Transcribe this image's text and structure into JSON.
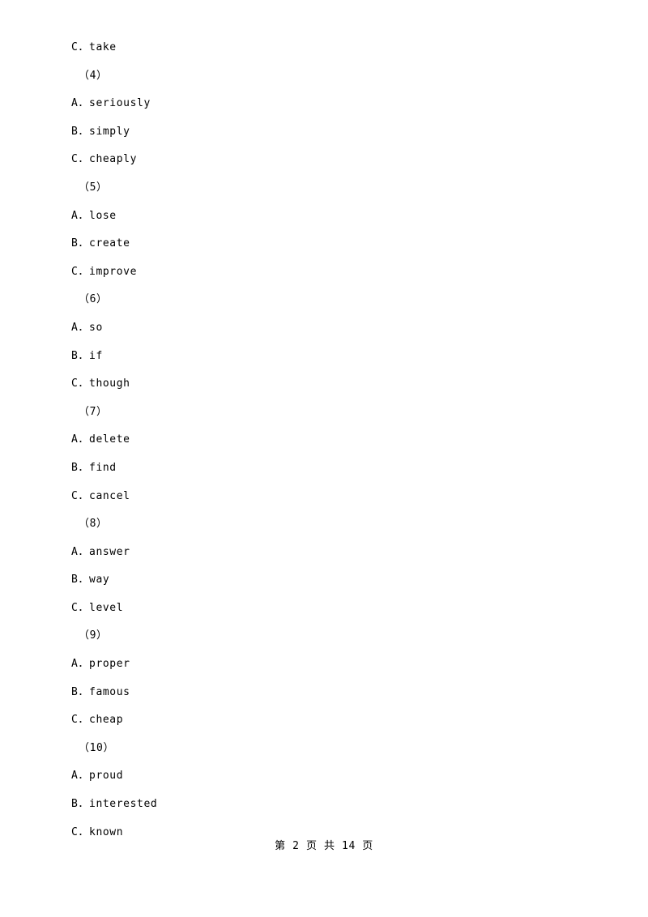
{
  "document": {
    "lines": [
      {
        "text": "C．take",
        "type": "option"
      },
      {
        "text": "（4）",
        "type": "qnum"
      },
      {
        "text": "A．seriously",
        "type": "option"
      },
      {
        "text": "B．simply",
        "type": "option"
      },
      {
        "text": "C．cheaply",
        "type": "option"
      },
      {
        "text": "（5）",
        "type": "qnum"
      },
      {
        "text": "A．lose",
        "type": "option"
      },
      {
        "text": "B．create",
        "type": "option"
      },
      {
        "text": "C．improve",
        "type": "option"
      },
      {
        "text": "（6）",
        "type": "qnum"
      },
      {
        "text": "A．so",
        "type": "option"
      },
      {
        "text": "B．if",
        "type": "option"
      },
      {
        "text": "C．though",
        "type": "option"
      },
      {
        "text": "（7）",
        "type": "qnum"
      },
      {
        "text": "A．delete",
        "type": "option"
      },
      {
        "text": "B．find",
        "type": "option"
      },
      {
        "text": "C．cancel",
        "type": "option"
      },
      {
        "text": "（8）",
        "type": "qnum"
      },
      {
        "text": "A．answer",
        "type": "option"
      },
      {
        "text": "B．way",
        "type": "option"
      },
      {
        "text": "C．level",
        "type": "option"
      },
      {
        "text": "（9）",
        "type": "qnum"
      },
      {
        "text": "A．proper",
        "type": "option"
      },
      {
        "text": "B．famous",
        "type": "option"
      },
      {
        "text": "C．cheap",
        "type": "option"
      },
      {
        "text": "（10）",
        "type": "qnum"
      },
      {
        "text": "A．proud",
        "type": "option"
      },
      {
        "text": "B．interested",
        "type": "option"
      },
      {
        "text": "C．known",
        "type": "option"
      }
    ],
    "footer": "第 2 页 共 14 页"
  }
}
